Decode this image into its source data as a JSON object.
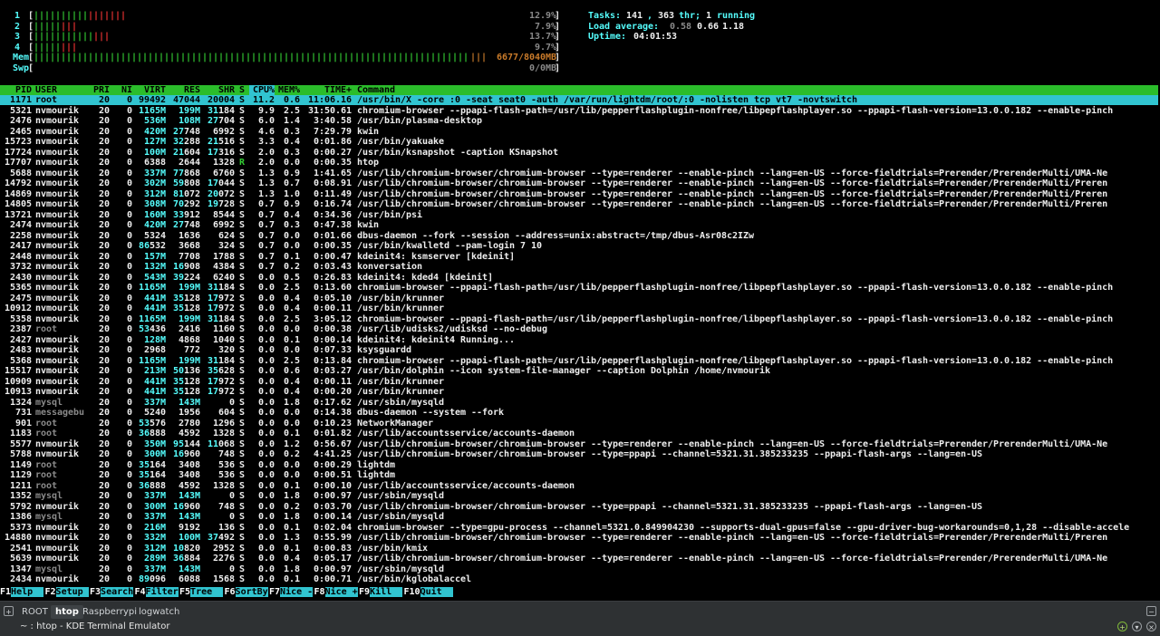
{
  "meters": {
    "cpu": [
      {
        "label": "1",
        "bars": [
          10,
          7
        ],
        "value": "12.9%"
      },
      {
        "label": "2",
        "bars": [
          5,
          3
        ],
        "value": "7.9%"
      },
      {
        "label": "3",
        "bars": [
          11,
          3
        ],
        "value": "13.7%"
      },
      {
        "label": "4",
        "bars": [
          5,
          3
        ],
        "value": "9.7%"
      }
    ],
    "mem": {
      "label": "Mem",
      "value": "6677/8040MB"
    },
    "swp": {
      "label": "Swp",
      "value": "0/0MB"
    },
    "tasks": {
      "label": "Tasks:",
      "count": "141",
      "threads": "363",
      "thr_label": "thr;",
      "running": "1",
      "running_label": "running"
    },
    "load": {
      "label": "Load average:",
      "v1": "0.58",
      "v5": "0.66",
      "v15": "1.18"
    },
    "uptime": {
      "label": "Uptime:",
      "value": "04:01:53"
    }
  },
  "columns": {
    "pid": "PID",
    "user": "USER",
    "pri": "PRI",
    "ni": "NI",
    "virt": "VIRT",
    "res": "RES",
    "shr": "SHR",
    "s": "S",
    "cpu": "CPU%",
    "mem": "MEM%",
    "time": "TIME+",
    "cmd": "Command"
  },
  "processes": [
    [
      "1171",
      "root",
      "20",
      "0",
      "99492",
      "47044",
      "20004",
      "S",
      "11.2",
      "0.6",
      "11:06.16",
      "/usr/bin/X -core :0 -seat seat0 -auth /var/run/lightdm/root/:0 -nolisten tcp vt7 -novtswitch"
    ],
    [
      "5321",
      "nvmourik",
      "20",
      "0",
      "1165M",
      "199M",
      "31184",
      "S",
      "9.9",
      "2.5",
      "31:50.61",
      "chromium-browser --ppapi-flash-path=/usr/lib/pepperflashplugin-nonfree/libpepflashplayer.so --ppapi-flash-version=13.0.0.182 --enable-pinch"
    ],
    [
      "2476",
      "nvmourik",
      "20",
      "0",
      "536M",
      "108M",
      "27704",
      "S",
      "6.0",
      "1.4",
      "3:40.58",
      "/usr/bin/plasma-desktop"
    ],
    [
      "2465",
      "nvmourik",
      "20",
      "0",
      "420M",
      "27748",
      "6992",
      "S",
      "4.6",
      "0.3",
      "7:29.79",
      "kwin"
    ],
    [
      "15723",
      "nvmourik",
      "20",
      "0",
      "127M",
      "32288",
      "21516",
      "S",
      "3.3",
      "0.4",
      "0:01.86",
      "/usr/bin/yakuake"
    ],
    [
      "17724",
      "nvmourik",
      "20",
      "0",
      "100M",
      "21604",
      "17316",
      "S",
      "2.0",
      "0.3",
      "0:00.27",
      "/usr/bin/ksnapshot -caption KSnapshot"
    ],
    [
      "17707",
      "nvmourik",
      "20",
      "0",
      "6388",
      "2644",
      "1328",
      "R",
      "2.0",
      "0.0",
      "0:00.35",
      "htop"
    ],
    [
      "5688",
      "nvmourik",
      "20",
      "0",
      "337M",
      "77868",
      "6760",
      "S",
      "1.3",
      "0.9",
      "1:41.65",
      "/usr/lib/chromium-browser/chromium-browser --type=renderer --enable-pinch --lang=en-US --force-fieldtrials=Prerender/PrerenderMulti/UMA-Ne"
    ],
    [
      "14792",
      "nvmourik",
      "20",
      "0",
      "302M",
      "59808",
      "17044",
      "S",
      "1.3",
      "0.7",
      "0:08.91",
      "/usr/lib/chromium-browser/chromium-browser --type=renderer --enable-pinch --lang=en-US --force-fieldtrials=Prerender/PrerenderMulti/Preren"
    ],
    [
      "14869",
      "nvmourik",
      "20",
      "0",
      "312M",
      "81072",
      "20072",
      "S",
      "1.3",
      "1.0",
      "0:11.49",
      "/usr/lib/chromium-browser/chromium-browser --type=renderer --enable-pinch --lang=en-US --force-fieldtrials=Prerender/PrerenderMulti/Preren"
    ],
    [
      "14805",
      "nvmourik",
      "20",
      "0",
      "308M",
      "70292",
      "19728",
      "S",
      "0.7",
      "0.9",
      "0:16.74",
      "/usr/lib/chromium-browser/chromium-browser --type=renderer --enable-pinch --lang=en-US --force-fieldtrials=Prerender/PrerenderMulti/Preren"
    ],
    [
      "13721",
      "nvmourik",
      "20",
      "0",
      "160M",
      "33912",
      "8544",
      "S",
      "0.7",
      "0.4",
      "0:34.36",
      "/usr/bin/psi"
    ],
    [
      "2474",
      "nvmourik",
      "20",
      "0",
      "420M",
      "27748",
      "6992",
      "S",
      "0.7",
      "0.3",
      "0:47.38",
      "kwin"
    ],
    [
      "2258",
      "nvmourik",
      "20",
      "0",
      "5324",
      "1636",
      "624",
      "S",
      "0.7",
      "0.0",
      "0:01.66",
      "dbus-daemon --fork --session --address=unix:abstract=/tmp/dbus-Asr08c2IZw"
    ],
    [
      "2417",
      "nvmourik",
      "20",
      "0",
      "86532",
      "3668",
      "324",
      "S",
      "0.7",
      "0.0",
      "0:00.35",
      "/usr/bin/kwalletd --pam-login 7 10"
    ],
    [
      "2448",
      "nvmourik",
      "20",
      "0",
      "157M",
      "7708",
      "1788",
      "S",
      "0.7",
      "0.1",
      "0:00.47",
      "kdeinit4: ksmserver [kdeinit]"
    ],
    [
      "3732",
      "nvmourik",
      "20",
      "0",
      "132M",
      "16908",
      "4384",
      "S",
      "0.7",
      "0.2",
      "0:03.43",
      "konversation"
    ],
    [
      "2430",
      "nvmourik",
      "20",
      "0",
      "543M",
      "39224",
      "6240",
      "S",
      "0.0",
      "0.5",
      "0:26.83",
      "kdeinit4: kded4 [kdeinit]"
    ],
    [
      "5365",
      "nvmourik",
      "20",
      "0",
      "1165M",
      "199M",
      "31184",
      "S",
      "0.0",
      "2.5",
      "0:13.60",
      "chromium-browser --ppapi-flash-path=/usr/lib/pepperflashplugin-nonfree/libpepflashplayer.so --ppapi-flash-version=13.0.0.182 --enable-pinch"
    ],
    [
      "2475",
      "nvmourik",
      "20",
      "0",
      "441M",
      "35128",
      "17972",
      "S",
      "0.0",
      "0.4",
      "0:05.10",
      "/usr/bin/krunner"
    ],
    [
      "10912",
      "nvmourik",
      "20",
      "0",
      "441M",
      "35128",
      "17972",
      "S",
      "0.0",
      "0.4",
      "0:00.11",
      "/usr/bin/krunner"
    ],
    [
      "5358",
      "nvmourik",
      "20",
      "0",
      "1165M",
      "199M",
      "31184",
      "S",
      "0.0",
      "2.5",
      "3:05.12",
      "chromium-browser --ppapi-flash-path=/usr/lib/pepperflashplugin-nonfree/libpepflashplayer.so --ppapi-flash-version=13.0.0.182 --enable-pinch"
    ],
    [
      "2387",
      "root",
      "20",
      "0",
      "53436",
      "2416",
      "1160",
      "S",
      "0.0",
      "0.0",
      "0:00.38",
      "/usr/lib/udisks2/udisksd --no-debug"
    ],
    [
      "2427",
      "nvmourik",
      "20",
      "0",
      "128M",
      "4868",
      "1040",
      "S",
      "0.0",
      "0.1",
      "0:00.14",
      "kdeinit4: kdeinit4 Running..."
    ],
    [
      "2483",
      "nvmourik",
      "20",
      "0",
      "2968",
      "772",
      "320",
      "S",
      "0.0",
      "0.0",
      "0:07.33",
      "ksysguardd"
    ],
    [
      "5368",
      "nvmourik",
      "20",
      "0",
      "1165M",
      "199M",
      "31184",
      "S",
      "0.0",
      "2.5",
      "0:13.84",
      "chromium-browser --ppapi-flash-path=/usr/lib/pepperflashplugin-nonfree/libpepflashplayer.so --ppapi-flash-version=13.0.0.182 --enable-pinch"
    ],
    [
      "15517",
      "nvmourik",
      "20",
      "0",
      "213M",
      "50136",
      "35628",
      "S",
      "0.0",
      "0.6",
      "0:03.27",
      "/usr/bin/dolphin --icon system-file-manager --caption Dolphin /home/nvmourik"
    ],
    [
      "10909",
      "nvmourik",
      "20",
      "0",
      "441M",
      "35128",
      "17972",
      "S",
      "0.0",
      "0.4",
      "0:00.11",
      "/usr/bin/krunner"
    ],
    [
      "10913",
      "nvmourik",
      "20",
      "0",
      "441M",
      "35128",
      "17972",
      "S",
      "0.0",
      "0.4",
      "0:00.20",
      "/usr/bin/krunner"
    ],
    [
      "1324",
      "mysql",
      "20",
      "0",
      "337M",
      "143M",
      "0",
      "S",
      "0.0",
      "1.8",
      "0:17.62",
      "/usr/sbin/mysqld"
    ],
    [
      "731",
      "messagebu",
      "20",
      "0",
      "5240",
      "1956",
      "604",
      "S",
      "0.0",
      "0.0",
      "0:14.38",
      "dbus-daemon --system --fork"
    ],
    [
      "901",
      "root",
      "20",
      "0",
      "53576",
      "2780",
      "1296",
      "S",
      "0.0",
      "0.0",
      "0:10.23",
      "NetworkManager"
    ],
    [
      "1183",
      "root",
      "20",
      "0",
      "36888",
      "4592",
      "1328",
      "S",
      "0.0",
      "0.1",
      "0:01.82",
      "/usr/lib/accountsservice/accounts-daemon"
    ],
    [
      "5577",
      "nvmourik",
      "20",
      "0",
      "350M",
      "95144",
      "11068",
      "S",
      "0.0",
      "1.2",
      "0:56.67",
      "/usr/lib/chromium-browser/chromium-browser --type=renderer --enable-pinch --lang=en-US --force-fieldtrials=Prerender/PrerenderMulti/UMA-Ne"
    ],
    [
      "5788",
      "nvmourik",
      "20",
      "0",
      "300M",
      "16960",
      "748",
      "S",
      "0.0",
      "0.2",
      "4:41.25",
      "/usr/lib/chromium-browser/chromium-browser --type=ppapi --channel=5321.31.385233235 --ppapi-flash-args --lang=en-US"
    ],
    [
      "1149",
      "root",
      "20",
      "0",
      "35164",
      "3408",
      "536",
      "S",
      "0.0",
      "0.0",
      "0:00.29",
      "lightdm"
    ],
    [
      "1129",
      "root",
      "20",
      "0",
      "35164",
      "3408",
      "536",
      "S",
      "0.0",
      "0.0",
      "0:00.51",
      "lightdm"
    ],
    [
      "1211",
      "root",
      "20",
      "0",
      "36888",
      "4592",
      "1328",
      "S",
      "0.0",
      "0.1",
      "0:00.10",
      "/usr/lib/accountsservice/accounts-daemon"
    ],
    [
      "1352",
      "mysql",
      "20",
      "0",
      "337M",
      "143M",
      "0",
      "S",
      "0.0",
      "1.8",
      "0:00.97",
      "/usr/sbin/mysqld"
    ],
    [
      "5792",
      "nvmourik",
      "20",
      "0",
      "300M",
      "16960",
      "748",
      "S",
      "0.0",
      "0.2",
      "0:03.70",
      "/usr/lib/chromium-browser/chromium-browser --type=ppapi --channel=5321.31.385233235 --ppapi-flash-args --lang=en-US"
    ],
    [
      "1386",
      "mysql",
      "20",
      "0",
      "337M",
      "143M",
      "0",
      "S",
      "0.0",
      "1.8",
      "0:00.14",
      "/usr/sbin/mysqld"
    ],
    [
      "5373",
      "nvmourik",
      "20",
      "0",
      "216M",
      "9192",
      "136",
      "S",
      "0.0",
      "0.1",
      "0:02.04",
      "chromium-browser --type=gpu-process --channel=5321.0.849904230 --supports-dual-gpus=false --gpu-driver-bug-workarounds=0,1,28 --disable-accele"
    ],
    [
      "14880",
      "nvmourik",
      "20",
      "0",
      "332M",
      "100M",
      "37492",
      "S",
      "0.0",
      "1.3",
      "0:55.99",
      "/usr/lib/chromium-browser/chromium-browser --type=renderer --enable-pinch --lang=en-US --force-fieldtrials=Prerender/PrerenderMulti/Preren"
    ],
    [
      "2541",
      "nvmourik",
      "20",
      "0",
      "312M",
      "10820",
      "2952",
      "S",
      "0.0",
      "0.1",
      "0:00.83",
      "/usr/bin/kmix"
    ],
    [
      "5639",
      "nvmourik",
      "20",
      "0",
      "289M",
      "36884",
      "2276",
      "S",
      "0.0",
      "0.4",
      "0:05.17",
      "/usr/lib/chromium-browser/chromium-browser --type=renderer --enable-pinch --lang=en-US --force-fieldtrials=Prerender/PrerenderMulti/UMA-Ne"
    ],
    [
      "1347",
      "mysql",
      "20",
      "0",
      "337M",
      "143M",
      "0",
      "S",
      "0.0",
      "1.8",
      "0:00.97",
      "/usr/sbin/mysqld"
    ],
    [
      "2434",
      "nvmourik",
      "20",
      "0",
      "89096",
      "6088",
      "1568",
      "S",
      "0.0",
      "0.1",
      "0:00.71",
      "/usr/bin/kglobalaccel"
    ]
  ],
  "fkeys": [
    {
      "key": "F1",
      "label": "Help  "
    },
    {
      "key": "F2",
      "label": "Setup "
    },
    {
      "key": "F3",
      "label": "Search"
    },
    {
      "key": "F4",
      "label": "Filter"
    },
    {
      "key": "F5",
      "label": "Tree  "
    },
    {
      "key": "F6",
      "label": "SortBy"
    },
    {
      "key": "F7",
      "label": "Nice -"
    },
    {
      "key": "F8",
      "label": "Nice +"
    },
    {
      "key": "F9",
      "label": "Kill  "
    },
    {
      "key": "F10",
      "label": "Quit  "
    }
  ],
  "tabs": [
    "ROOT",
    "htop",
    "Raspberrypi",
    "logwatch"
  ],
  "active_tab": "htop",
  "window_title": "~ : htop - KDE Terminal Emulator"
}
